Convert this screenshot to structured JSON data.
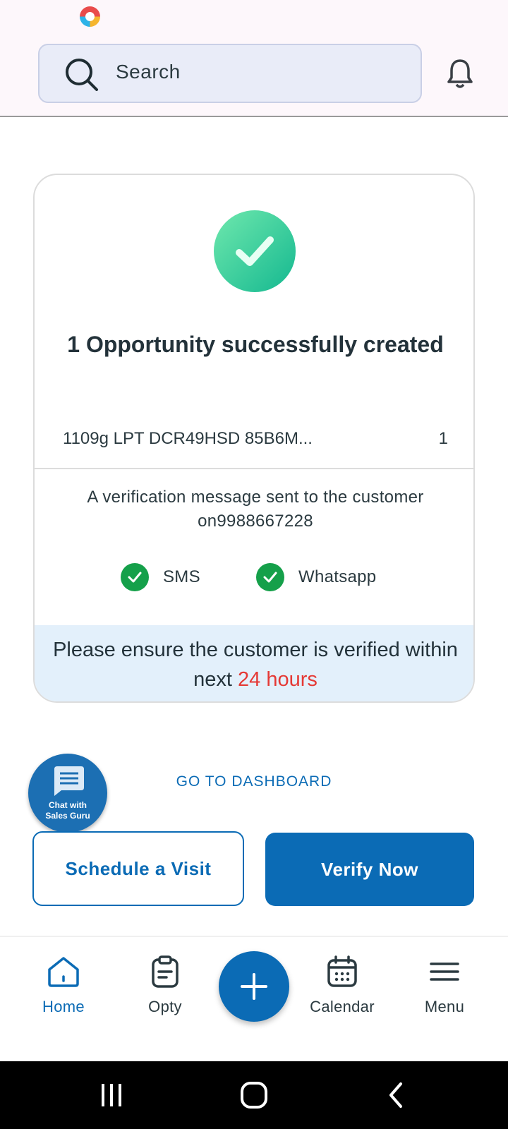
{
  "header": {
    "search_placeholder": "Search"
  },
  "card": {
    "title": "1 Opportunity successfully created",
    "item": {
      "name": "1109g LPT DCR49HSD 85B6M...",
      "qty": "1"
    },
    "verification_message": "A verification message sent to the customer on9988667228",
    "channels": [
      {
        "label": "SMS"
      },
      {
        "label": "Whatsapp"
      }
    ],
    "notice": {
      "text": "Please ensure the customer is verified within next ",
      "highlight": "24 hours"
    }
  },
  "actions": {
    "dashboard_link": "GO TO DASHBOARD",
    "schedule_button": "Schedule a Visit",
    "verify_button": "Verify Now"
  },
  "chat_fab": {
    "line1": "Chat with",
    "line2": "Sales Guru"
  },
  "bottom_nav": {
    "items": [
      {
        "label": "Home",
        "icon": "home-icon",
        "active": true
      },
      {
        "label": "Opty",
        "icon": "clipboard-icon"
      },
      {
        "label": "Calendar",
        "icon": "calendar-icon"
      },
      {
        "label": "Menu",
        "icon": "menu-icon"
      }
    ]
  },
  "colors": {
    "primary": "#0b6bb5",
    "success": "#15a04a",
    "highlight": "#e53935",
    "notice_bg": "#e3f0fb"
  }
}
